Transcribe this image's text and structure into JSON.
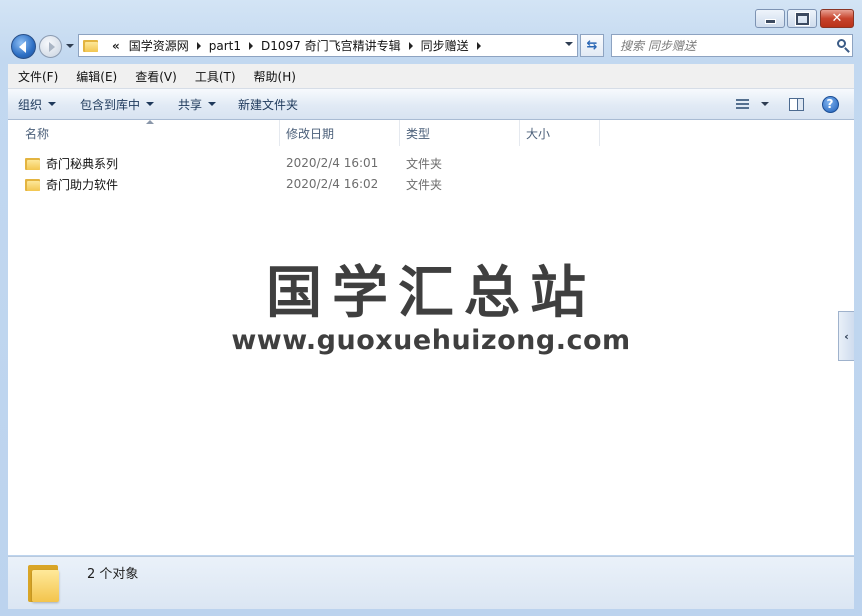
{
  "window": {
    "controls": {
      "minimize": "minimize",
      "maximize": "maximize",
      "close": "close"
    }
  },
  "nav": {
    "overflow_chevron": "«",
    "breadcrumbs": [
      "国学资源网",
      "part1",
      "D1097 奇门飞宫精讲专辑",
      "同步赠送"
    ]
  },
  "search": {
    "placeholder": "搜索 同步赠送"
  },
  "menubar": {
    "items": [
      "文件(F)",
      "编辑(E)",
      "查看(V)",
      "工具(T)",
      "帮助(H)"
    ]
  },
  "toolbar": {
    "organize": "组织",
    "include_in_library": "包含到库中",
    "share": "共享",
    "new_folder": "新建文件夹"
  },
  "columns": {
    "name": "名称",
    "modified": "修改日期",
    "type": "类型",
    "size": "大小"
  },
  "files": [
    {
      "name": "奇门秘典系列",
      "modified": "2020/2/4 16:01",
      "type": "文件夹",
      "size": ""
    },
    {
      "name": "奇门助力软件",
      "modified": "2020/2/4 16:02",
      "type": "文件夹",
      "size": ""
    }
  ],
  "watermark": {
    "title": "国学汇总站",
    "url": "www.guoxuehuizong.com"
  },
  "status": {
    "count_text": "2 个对象"
  },
  "colors": {
    "folder": "#f3c650",
    "accent": "#2d6fc4",
    "toolbar_text": "#1e395b"
  }
}
